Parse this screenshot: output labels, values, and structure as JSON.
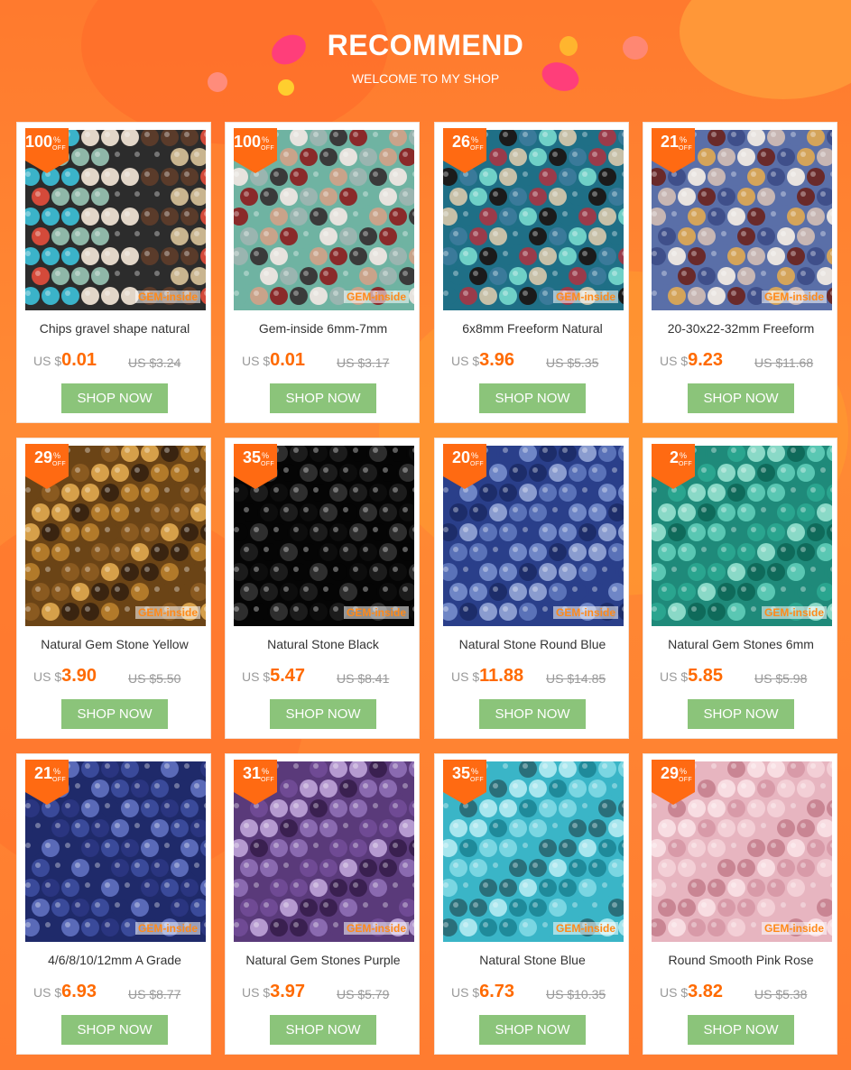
{
  "header": {
    "title": "RECOMMEND",
    "subtitle": "WELCOME TO MY SHOP"
  },
  "colors": {
    "accent": "#ff6a00",
    "button": "#8bc47a",
    "badge": "#ff6a12",
    "background": "#ff7a2e"
  },
  "badge_text": {
    "percent": "%",
    "off": "OFF"
  },
  "brand_watermark": "GEM-inside",
  "products": [
    {
      "discount": "100",
      "title": "Chips gravel shape natural",
      "currency": "US $",
      "price": "0.01",
      "old_price": "US $3.24",
      "button": "SHOP NOW",
      "palette": [
        "#2c2c2c",
        "#c9b58f",
        "#3bb3c9",
        "#e2d6c8",
        "#5a3b2a",
        "#d44a3a",
        "#8fb7a8"
      ]
    },
    {
      "discount": "100",
      "title": "Gem-inside 6mm-7mm",
      "currency": "US $",
      "price": "0.01",
      "old_price": "US $3.17",
      "button": "SHOP NOW",
      "palette": [
        "#6fb3a2",
        "#3a3a3a",
        "#c9a38a",
        "#e7e3de",
        "#8a2a2a",
        "#9ab5b0"
      ]
    },
    {
      "discount": "26",
      "title": "6x8mm Freeform Natural",
      "currency": "US $",
      "price": "3.96",
      "old_price": "US $5.35",
      "button": "SHOP NOW",
      "palette": [
        "#1f6f86",
        "#6fd0c7",
        "#9a3b4a",
        "#1b1b1b",
        "#c7c0a8",
        "#3a7a9a"
      ]
    },
    {
      "discount": "21",
      "title": "20-30x22-32mm Freeform",
      "currency": "US $",
      "price": "9.23",
      "old_price": "US $11.68",
      "button": "SHOP NOW",
      "palette": [
        "#5a6fa8",
        "#e8e3df",
        "#d4a45a",
        "#6a2a2a",
        "#c7b6b3",
        "#3f4f8a"
      ]
    },
    {
      "discount": "29",
      "title": "Natural Gem Stone Yellow",
      "currency": "US $",
      "price": "3.90",
      "old_price": "US $5.50",
      "button": "SHOP NOW",
      "palette": [
        "#6b4416",
        "#b27a2a",
        "#3a2410",
        "#d6a04a",
        "#8a5a20"
      ]
    },
    {
      "discount": "35",
      "title": "Natural Stone Black",
      "currency": "US $",
      "price": "5.47",
      "old_price": "US $8.41",
      "button": "SHOP NOW",
      "palette": [
        "#050505",
        "#1c1c1c",
        "#2e2e2e",
        "#0d0d0d"
      ]
    },
    {
      "discount": "20",
      "title": "Natural Stone Round Blue",
      "currency": "US $",
      "price": "11.88",
      "old_price": "US $14.85",
      "button": "SHOP NOW",
      "palette": [
        "#2a3f8a",
        "#5a72b8",
        "#8a9ccf",
        "#1d2d6a",
        "#6f86c6"
      ]
    },
    {
      "discount": "2",
      "title": "Natural Gem Stones 6mm",
      "currency": "US $",
      "price": "5.85",
      "old_price": "US $5.98",
      "button": "SHOP NOW",
      "palette": [
        "#1f8a7a",
        "#5ac7b3",
        "#0f6a5a",
        "#8ad9c7",
        "#2aa58f"
      ]
    },
    {
      "discount": "21",
      "title": "4/6/8/10/12mm A Grade",
      "currency": "US $",
      "price": "6.93",
      "old_price": "US $8.77",
      "button": "SHOP NOW",
      "palette": [
        "#1f2a6a",
        "#3a4a9a",
        "#5a6ab8",
        "#2a3580"
      ]
    },
    {
      "discount": "31",
      "title": "Natural Gem Stones Purple",
      "currency": "US $",
      "price": "3.97",
      "old_price": "US $5.79",
      "button": "SHOP NOW",
      "palette": [
        "#5a3a7a",
        "#8a6ab0",
        "#3a2050",
        "#b59ad0",
        "#6f4a94"
      ]
    },
    {
      "discount": "35",
      "title": "Natural Stone Blue",
      "currency": "US $",
      "price": "6.73",
      "old_price": "US $10.35",
      "button": "SHOP NOW",
      "palette": [
        "#3ab5c7",
        "#7ad6e2",
        "#1f8a9a",
        "#a8e6ee",
        "#2a6f7a"
      ]
    },
    {
      "discount": "29",
      "title": "Round Smooth Pink Rose",
      "currency": "US $",
      "price": "3.82",
      "old_price": "US $5.38",
      "button": "SHOP NOW",
      "palette": [
        "#e7b5c0",
        "#f3cfd6",
        "#d89aa8",
        "#f8dde2",
        "#c98593"
      ]
    }
  ]
}
